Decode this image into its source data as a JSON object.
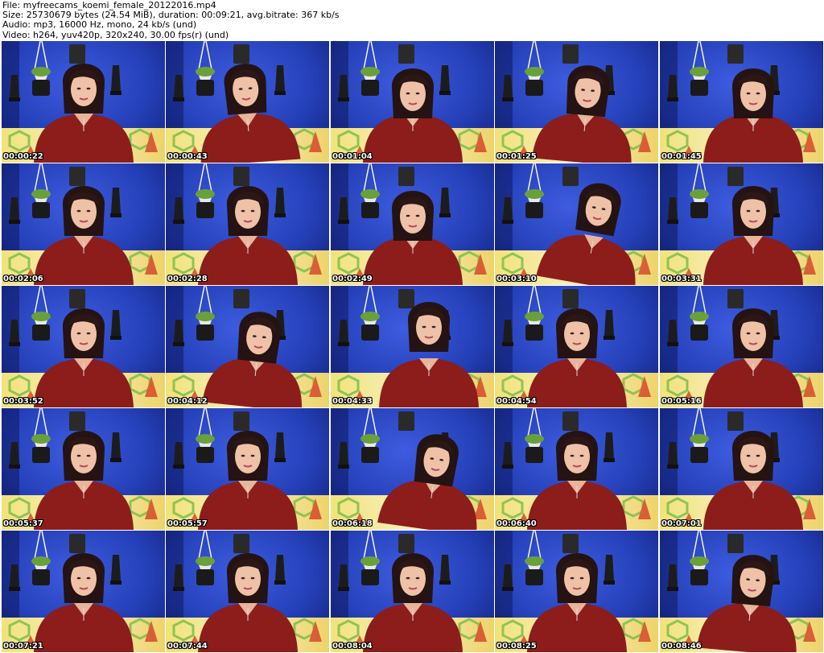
{
  "info": {
    "file": "File: myfreecams_koemi_female_20122016.mp4",
    "size": "Size: 25730679 bytes (24.54 MiB), duration: 00:09:21, avg.bitrate: 367 kb/s",
    "audio": "Audio: mp3, 16000 Hz, mono, 24 kb/s (und)",
    "video": "Video: h264, yuv420p, 320x240, 30.00 fps(r) (und)"
  },
  "thumbnails": [
    {
      "timestamp": "00:00:22",
      "pose": "center"
    },
    {
      "timestamp": "00:00:43",
      "pose": "hand-chin"
    },
    {
      "timestamp": "00:01:04",
      "pose": "down"
    },
    {
      "timestamp": "00:01:25",
      "pose": "hand-chin-right"
    },
    {
      "timestamp": "00:01:45",
      "pose": "turned-away"
    },
    {
      "timestamp": "00:02:06",
      "pose": "center"
    },
    {
      "timestamp": "00:02:28",
      "pose": "center"
    },
    {
      "timestamp": "00:02:49",
      "pose": "down"
    },
    {
      "timestamp": "00:03:10",
      "pose": "lean-right"
    },
    {
      "timestamp": "00:03:31",
      "pose": "center-right"
    },
    {
      "timestamp": "00:03:52",
      "pose": "center"
    },
    {
      "timestamp": "00:04:12",
      "pose": "close-right"
    },
    {
      "timestamp": "00:04:33",
      "pose": "high"
    },
    {
      "timestamp": "00:04:54",
      "pose": "center"
    },
    {
      "timestamp": "00:05:16",
      "pose": "center-right"
    },
    {
      "timestamp": "00:05:37",
      "pose": "center"
    },
    {
      "timestamp": "00:05:57",
      "pose": "center"
    },
    {
      "timestamp": "00:06:18",
      "pose": "lean-down"
    },
    {
      "timestamp": "00:06:40",
      "pose": "center"
    },
    {
      "timestamp": "00:07:01",
      "pose": "center-right"
    },
    {
      "timestamp": "00:07:21",
      "pose": "center"
    },
    {
      "timestamp": "00:07:44",
      "pose": "center"
    },
    {
      "timestamp": "00:08:04",
      "pose": "center"
    },
    {
      "timestamp": "00:08:25",
      "pose": "center"
    },
    {
      "timestamp": "00:08:46",
      "pose": "hand-chin-right"
    }
  ]
}
